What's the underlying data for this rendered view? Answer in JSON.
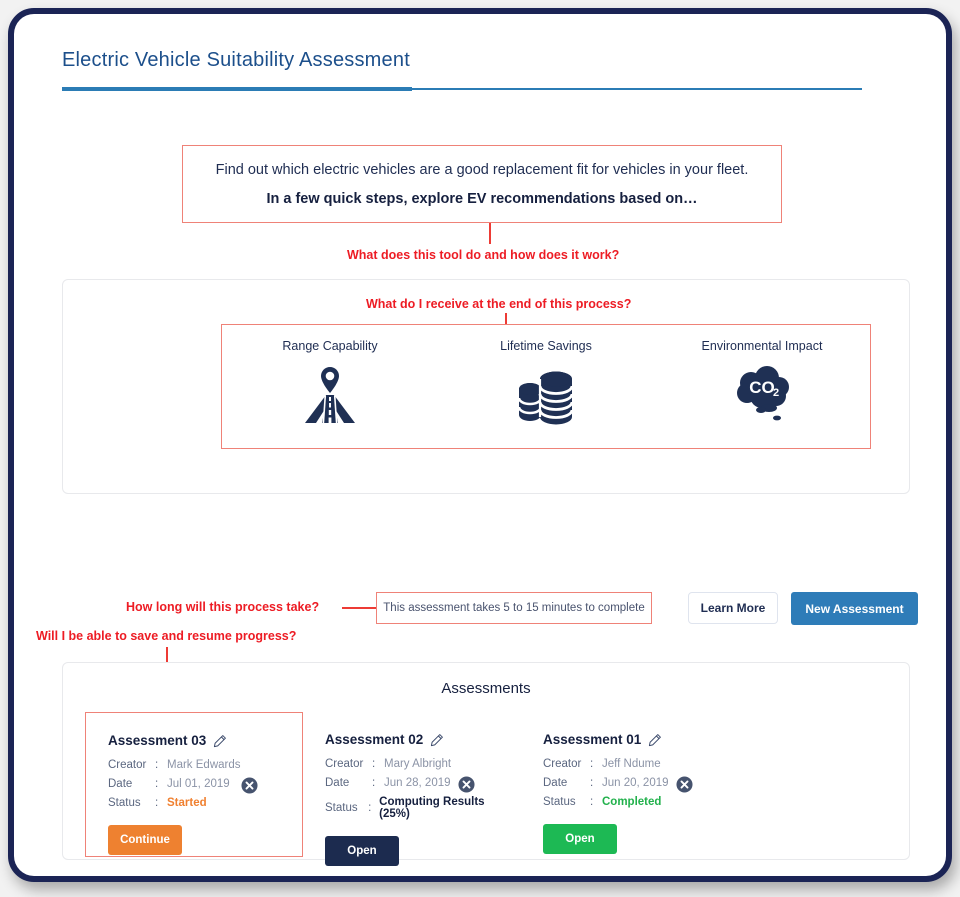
{
  "header": {
    "title": "Electric Vehicle Suitability Assessment"
  },
  "intro": {
    "line1": "Find out which electric vehicles are a good replacement fit for vehicles in your fleet.",
    "line2": "In a few quick steps, explore EV recommendations based on…"
  },
  "annotations": {
    "tool_purpose": "What does this tool do and how does it work?",
    "process_output": "What do I receive at the end of this process?",
    "process_duration": "How long will this process take?",
    "save_resume": "Will I be able to save and resume progress?"
  },
  "features": [
    {
      "label": "Range Capability",
      "icon": "road-pin-icon"
    },
    {
      "label": "Lifetime Savings",
      "icon": "coin-stack-icon"
    },
    {
      "label": "Environmental Impact",
      "icon": "co2-cloud-icon"
    }
  ],
  "controls": {
    "timing_text": "This assessment takes 5 to 15 minutes to complete",
    "learn_more_label": "Learn More",
    "new_assessment_label": "New Assessment"
  },
  "assessments": {
    "heading": "Assessments",
    "labels": {
      "creator": "Creator",
      "date": "Date",
      "status": "Status",
      "colon": ":"
    },
    "cards": [
      {
        "title": "Assessment 03",
        "creator": "Mark Edwards",
        "date": "Jul 01, 2019",
        "status": "Started",
        "status_kind": "started",
        "action_label": "Continue",
        "action_kind": "continue",
        "highlighted": true
      },
      {
        "title": "Assessment 02",
        "creator": "Mary Albright",
        "date": "Jun 28, 2019",
        "status": "Computing Results (25%)",
        "status_kind": "computing",
        "action_label": "Open",
        "action_kind": "open-dark",
        "highlighted": false
      },
      {
        "title": "Assessment 01",
        "creator": "Jeff Ndume",
        "date": "Jun 20, 2019",
        "status": "Completed",
        "status_kind": "completed",
        "action_label": "Open",
        "action_kind": "open-green",
        "highlighted": false
      }
    ]
  },
  "colors": {
    "title_blue": "#1c4f8b",
    "rule_blue": "#2b7cb5",
    "annotation_red": "#ed1c24",
    "box_red": "#ef8278",
    "navy": "#16203f",
    "primary_blue": "#2e7cb8",
    "orange": "#ee8130",
    "green": "#1db954",
    "frame_navy": "#1b2455"
  }
}
